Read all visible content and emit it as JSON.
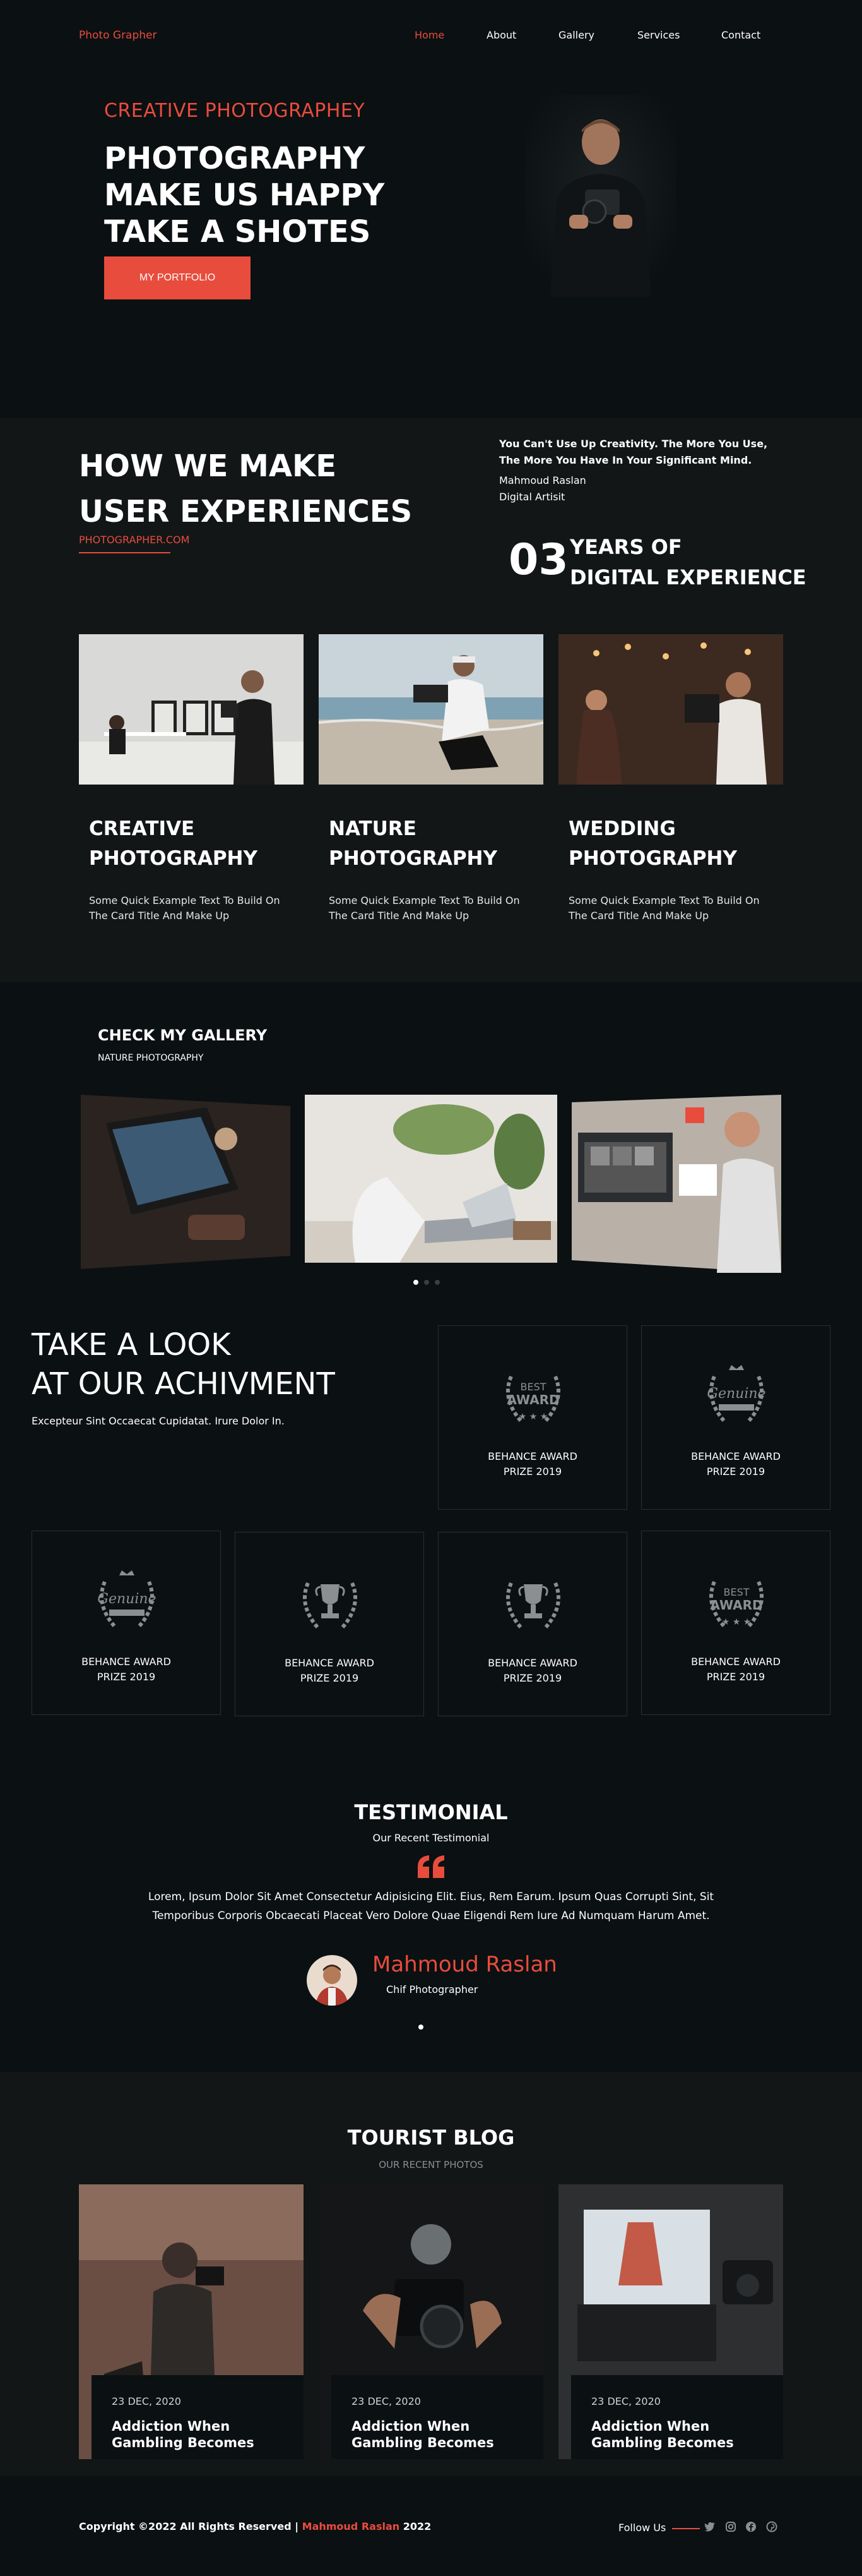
{
  "nav": {
    "logo": "Photo Grapher",
    "links": [
      "Home",
      "About",
      "Gallery",
      "Services",
      "Contact"
    ],
    "active": "Home"
  },
  "hero": {
    "kicker": "CREATIVE PHOTOGRAPHEY",
    "title": "PHOTOGRAPHY MAKE US HAPPY TAKE A SHOTES",
    "button": "MY PORTFOLIO"
  },
  "how": {
    "title": "HOW WE MAKE USER EXPERIENCES",
    "link": "PHOTOGRAPHER.COM",
    "quote": "You Can't Use Up Creativity. The More You Use, The More You Have In Your Significant Mind.",
    "author_name": "Mahmoud Raslan",
    "author_role": "Digital Artisit",
    "years_number": "03",
    "years_line1": "YEARS OF",
    "years_line2": "DIGITAL EXPERIENCE",
    "cards": [
      {
        "title_line1": "CREATIVE",
        "title_line2": "PHOTOGRAPHY",
        "text": "Some Quick Example Text To Build On The Card Title And Make Up"
      },
      {
        "title_line1": "NATURE",
        "title_line2": "PHOTOGRAPHY",
        "text": "Some Quick Example Text To Build On The Card Title And Make Up"
      },
      {
        "title_line1": "WEDDING",
        "title_line2": "PHOTOGRAPHY",
        "text": "Some Quick Example Text To Build On The Card Title And Make Up"
      }
    ]
  },
  "gallery": {
    "title": "CHECK MY GALLERY",
    "subtitle": "NATURE PHOTOGRAPHY"
  },
  "achievement": {
    "title_line1": "TAKE A LOOK",
    "title_line2": "AT OUR ACHIVMENT",
    "subtitle": "Excepteur Sint Occaecat Cupidatat. Irure Dolor In.",
    "awards": [
      {
        "line1": "BEHANCE AWARD",
        "line2": "PRIZE 2019",
        "badge": "BEST AWARD"
      },
      {
        "line1": "BEHANCE AWARD",
        "line2": "PRIZE 2019",
        "badge": "Genuine"
      },
      {
        "line1": "BEHANCE AWARD",
        "line2": "PRIZE 2019",
        "badge": "Genuine"
      },
      {
        "line1": "BEHANCE AWARD",
        "line2": "PRIZE 2019",
        "badge": "trophy"
      },
      {
        "line1": "BEHANCE AWARD",
        "line2": "PRIZE 2019",
        "badge": "trophy"
      },
      {
        "line1": "BEHANCE AWARD",
        "line2": "PRIZE 2019",
        "badge": "BEST AWARD"
      }
    ]
  },
  "testimonial": {
    "title": "TESTIMONIAL",
    "subtitle": "Our Recent Testimonial",
    "text_line1": "Lorem, Ipsum Dolor Sit Amet Consectetur Adipisicing Elit. Eius, Rem Earum. Ipsum Quas Corrupti Sint, Sit",
    "text_line2": "Temporibus Corporis Obcaecati Placeat Vero Dolore Quae Eligendi Rem Iure Ad Numquam Harum Amet.",
    "name": "Mahmoud Raslan",
    "role": "Chif Photographer"
  },
  "blog": {
    "title": "TOURIST BLOG",
    "subtitle": "OUR RECENT PHOTOS",
    "posts": [
      {
        "date": "23 DEC, 2020",
        "title": "Addiction When Gambling Becomes"
      },
      {
        "date": "23 DEC, 2020",
        "title": "Addiction When Gambling Becomes"
      },
      {
        "date": "23 DEC, 2020",
        "title": "Addiction When Gambling Becomes"
      }
    ]
  },
  "footer": {
    "copy_prefix": "Copyright ©2022 All Rights Reserved |",
    "copy_name": "Mahmoud Raslan",
    "copy_year": "2022",
    "follow": "Follow Us"
  },
  "colors": {
    "accent": "#e84c3d",
    "bg": "#0b1012",
    "bg_alt": "#121617"
  }
}
